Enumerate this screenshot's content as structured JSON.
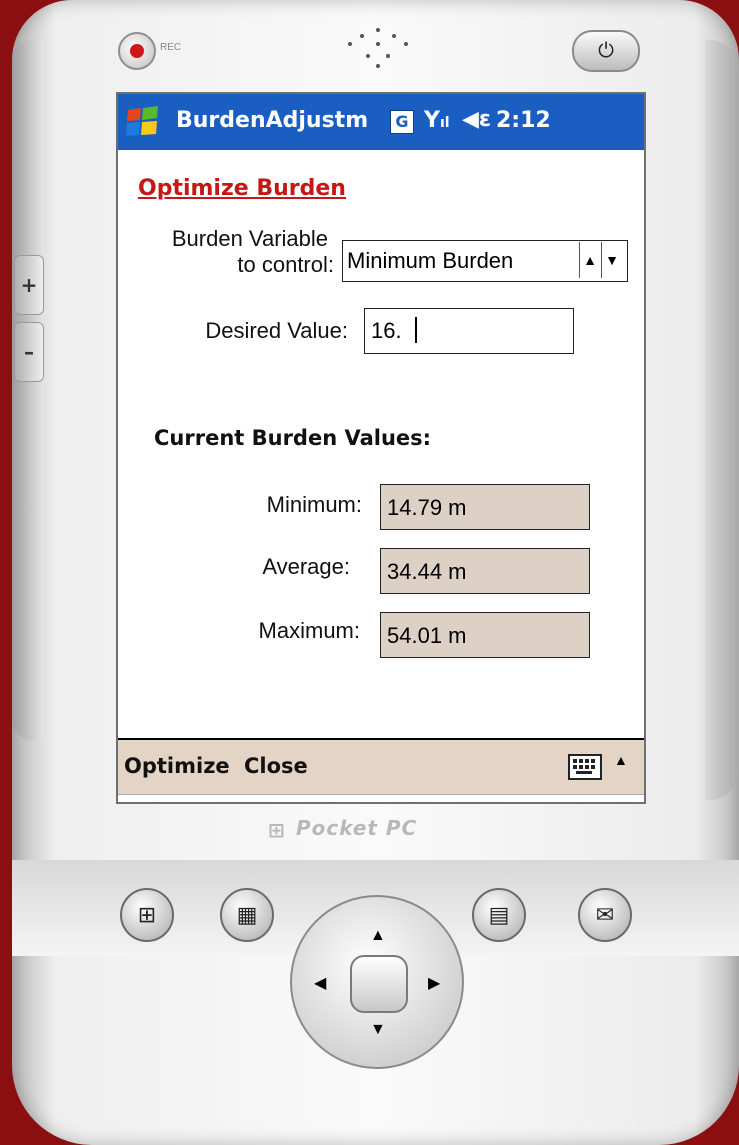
{
  "device": {
    "rec_label": "REC",
    "brand": "Pocket PC",
    "left_buttons": [
      "+",
      "–"
    ],
    "power_icon": "power-icon",
    "hardware_buttons": [
      "windows-start-icon",
      "calendar-icon",
      "contacts-icon",
      "inbox-icon"
    ]
  },
  "titlebar": {
    "app_name": "BurdenAdjustm",
    "gprs": "G",
    "signal_icon": "signal-icon",
    "volume_icon": "volume-icon",
    "time": "2:12",
    "color": "#1a5ec2"
  },
  "form": {
    "title": "Optimize Burden",
    "variable_label_line1": "Burden Variable",
    "variable_label_line2": "to control:",
    "variable_value": "Minimum Burden",
    "desired_label": "Desired Value:",
    "desired_value": "16.",
    "section_title": "Current Burden Values:",
    "minimum_label": "Minimum:",
    "minimum_value": "14.79 m",
    "average_label": "Average:",
    "average_value": "34.44 m",
    "maximum_label": "Maximum:",
    "maximum_value": "54.01 m",
    "readonly_color": "#ddd1c6",
    "title_color": "#c41818"
  },
  "menu": {
    "optimize": "Optimize",
    "close": "Close"
  }
}
